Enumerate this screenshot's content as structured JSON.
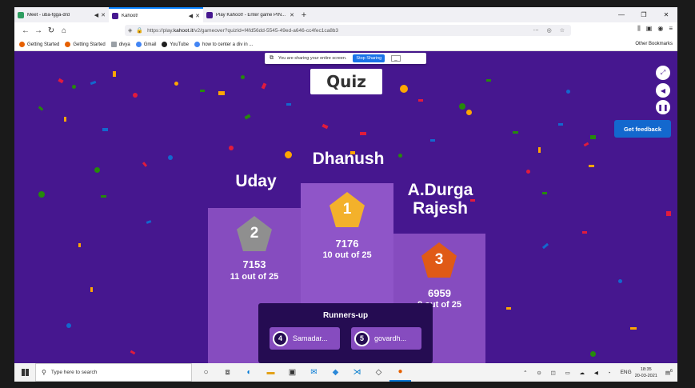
{
  "browser": {
    "tabs": [
      {
        "title": "Meet - uba-fgga-drd",
        "color": "#2f9e61",
        "audio": "◀)",
        "active": false
      },
      {
        "title": "Kahoot!",
        "color": "#46178f",
        "audio": "◀)",
        "active": true
      },
      {
        "title": "Play Kahoot! - Enter game PIN...",
        "color": "#46178f",
        "audio": "",
        "active": false
      }
    ],
    "new_tab": "+",
    "url_prefix": "https://play.",
    "url_domain": "kahoot.it",
    "url_rest": "/v2/gameover?quizId=f4fd56dd-5545-49ed-a646-cc4fec1ca8b3",
    "bookmarks": [
      {
        "label": "Getting Started",
        "color": "#e66000"
      },
      {
        "label": "Getting Started",
        "color": "#e66000"
      },
      {
        "label": "divya",
        "color": "#9aa0a6"
      },
      {
        "label": "Gmail",
        "color": "#4285f4"
      },
      {
        "label": "YouTube",
        "color": "#202020"
      },
      {
        "label": "how to center a div in ...",
        "color": "#4285f4"
      }
    ],
    "other_bookmarks": "Other Bookmarks"
  },
  "sharing": {
    "message": "You are sharing your entire screen.",
    "stop_label": "Stop Sharing",
    "min_label": "_"
  },
  "game": {
    "logo": "Quiz",
    "feedback_label": "Get feedback",
    "podium": [
      {
        "rank": "2",
        "name": "Uday",
        "score": "7153",
        "correct": "11 out of 25"
      },
      {
        "rank": "1",
        "name": "Dhanush",
        "score": "7176",
        "correct": "10 out of 25"
      },
      {
        "rank": "3",
        "name": "A.Durga Rajesh",
        "score": "6959",
        "correct": "8 out of 25"
      }
    ],
    "runners_up_title": "Runners-up",
    "runners_up": [
      {
        "rank": "4",
        "name": "Samadar..."
      },
      {
        "rank": "5",
        "name": "govardh..."
      }
    ]
  },
  "taskbar": {
    "search_placeholder": "Type here to search",
    "lang": "ENG",
    "time": "18:35",
    "date": "20-03-2021",
    "notifications": "6"
  }
}
